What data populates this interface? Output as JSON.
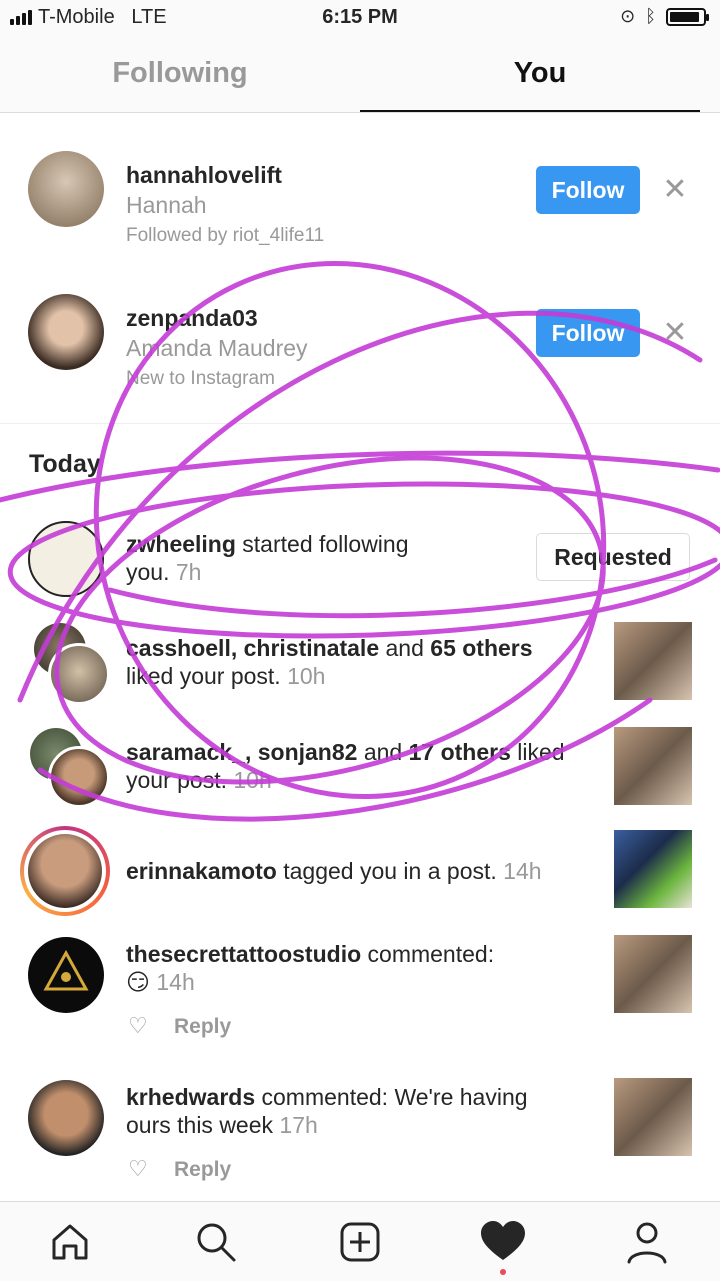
{
  "status": {
    "carrier": "T-Mobile",
    "network": "LTE",
    "time": "6:15 PM"
  },
  "tabs": [
    {
      "label": "Following"
    },
    {
      "label": "You"
    }
  ],
  "suggestions": [
    {
      "username": "hannahlovelift",
      "name": "Hannah",
      "note": "Followed by riot_4life11",
      "button": "Follow"
    },
    {
      "username": "zenpanda03",
      "name": "Amanda Maudrey",
      "note": "New to Instagram",
      "button": "Follow"
    }
  ],
  "section_title": "Today",
  "activity": [
    {
      "user": "zwheeling",
      "text1": " started following",
      "text2": "you.",
      "time": "7h",
      "button": "Requested"
    },
    {
      "users": "casshoell, christinatale",
      "mid": " and ",
      "others": "65 others",
      "text2": "liked your post.",
      "time": "10h"
    },
    {
      "users": "saramack_, sonjan82",
      "mid": " and ",
      "others": "17 others",
      "tail": " liked",
      "text2": "your post.",
      "time": "10h"
    },
    {
      "user": "erinnakamoto",
      "text1": " tagged you in a post.",
      "time": "14h"
    },
    {
      "user": "thesecrettattoostudio",
      "text1": " commented:",
      "emoji": "😏",
      "time": "14h",
      "reply": "Reply"
    },
    {
      "user": "krhedwards",
      "text1": " commented: We're having",
      "text2": "ours this week",
      "time": "17h",
      "reply": "Reply"
    }
  ],
  "nav": [
    "home-icon",
    "search-icon",
    "add-icon",
    "heart-icon",
    "profile-icon"
  ],
  "colors": {
    "accent": "#3897f0",
    "scribble": "#c43cd6",
    "notification_dot": "#ed4956"
  }
}
